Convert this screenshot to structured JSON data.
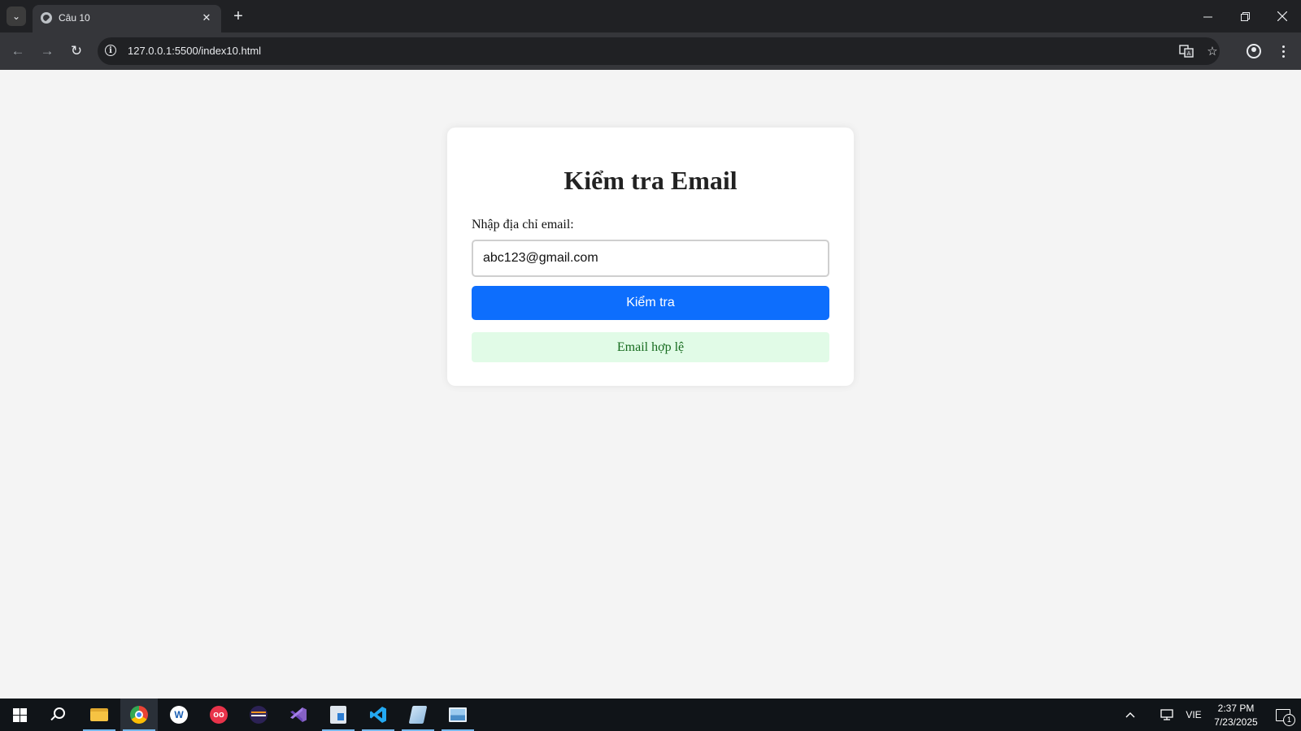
{
  "browser": {
    "tab_title": "Câu 10",
    "url": "127.0.0.1:5500/index10.html",
    "new_tab_symbol": "+"
  },
  "page": {
    "heading": "Kiểm tra Email",
    "field_label": "Nhập địa chỉ email:",
    "email_value": "abc123@gmail.com",
    "check_button_label": "Kiểm tra",
    "result_message": "Email hợp lệ",
    "colors": {
      "button": "#0d6efd",
      "result_background": "#e1fbe7",
      "result_text": "#166b1e"
    }
  },
  "taskbar": {
    "apps": [
      "file-explorer-icon",
      "chrome-icon",
      "app-w-icon",
      "app-oo-icon",
      "eclipse-icon",
      "visual-studio-icon",
      "app-notes-icon",
      "vscode-icon",
      "app-book-icon",
      "app-photos-icon"
    ],
    "language": "VIE",
    "time": "2:37 PM",
    "date": "7/23/2025",
    "notification_count": "1"
  }
}
